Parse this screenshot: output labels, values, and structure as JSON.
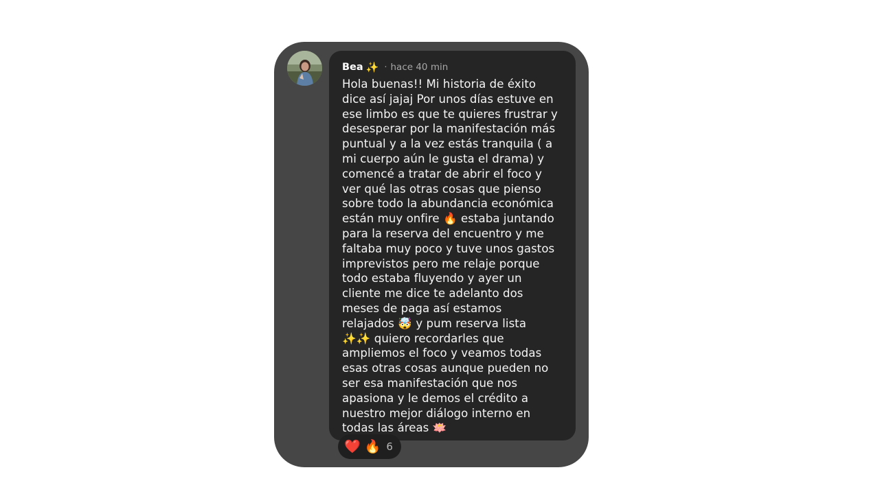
{
  "comment": {
    "author": "Bea",
    "author_emoji": "✨",
    "separator": "·",
    "timestamp": "hace 40 min",
    "message_lines": [
      "Hola buenas!! Mi historia de éxito",
      "dice así jajaj Por unos días estuve en",
      "ese limbo es que te quieres frustrar y",
      "desesperar por la manifestación más",
      "puntual y a la vez estás tranquila ( a",
      "mi cuerpo aún le gusta el drama) y",
      "comencé a tratar de abrir el foco y",
      "ver qué las otras cosas que pienso",
      "sobre todo la abundancia económica",
      "están muy onfire 🔥 estaba juntando",
      "para la reserva del encuentro y me",
      "faltaba muy poco y tuve unos gastos",
      "imprevistos pero me relaje porque",
      "todo estaba fluyendo y ayer un",
      "cliente me dice te adelanto dos",
      "meses de paga así estamos",
      "relajados 🤯 y pum reserva lista",
      "✨✨ quiero recordarles que",
      "ampliemos el foco y veamos todas",
      "esas otras cosas aunque pueden no",
      "ser esa manifestación que nos",
      "apasiona y le demos el crédito a",
      "nuestro mejor diálogo interno en",
      "todas las áreas 🪷"
    ]
  },
  "reactions": {
    "items": [
      {
        "emoji": "❤️",
        "icon": "heart-icon"
      },
      {
        "emoji": "🔥",
        "icon": "fire-icon"
      }
    ],
    "count": "6"
  },
  "colors": {
    "frame": "#464646",
    "bubble": "#252525",
    "reaction_pill": "#1f1f1f",
    "text": "#f4f4f4",
    "muted": "#a7a7a7"
  }
}
